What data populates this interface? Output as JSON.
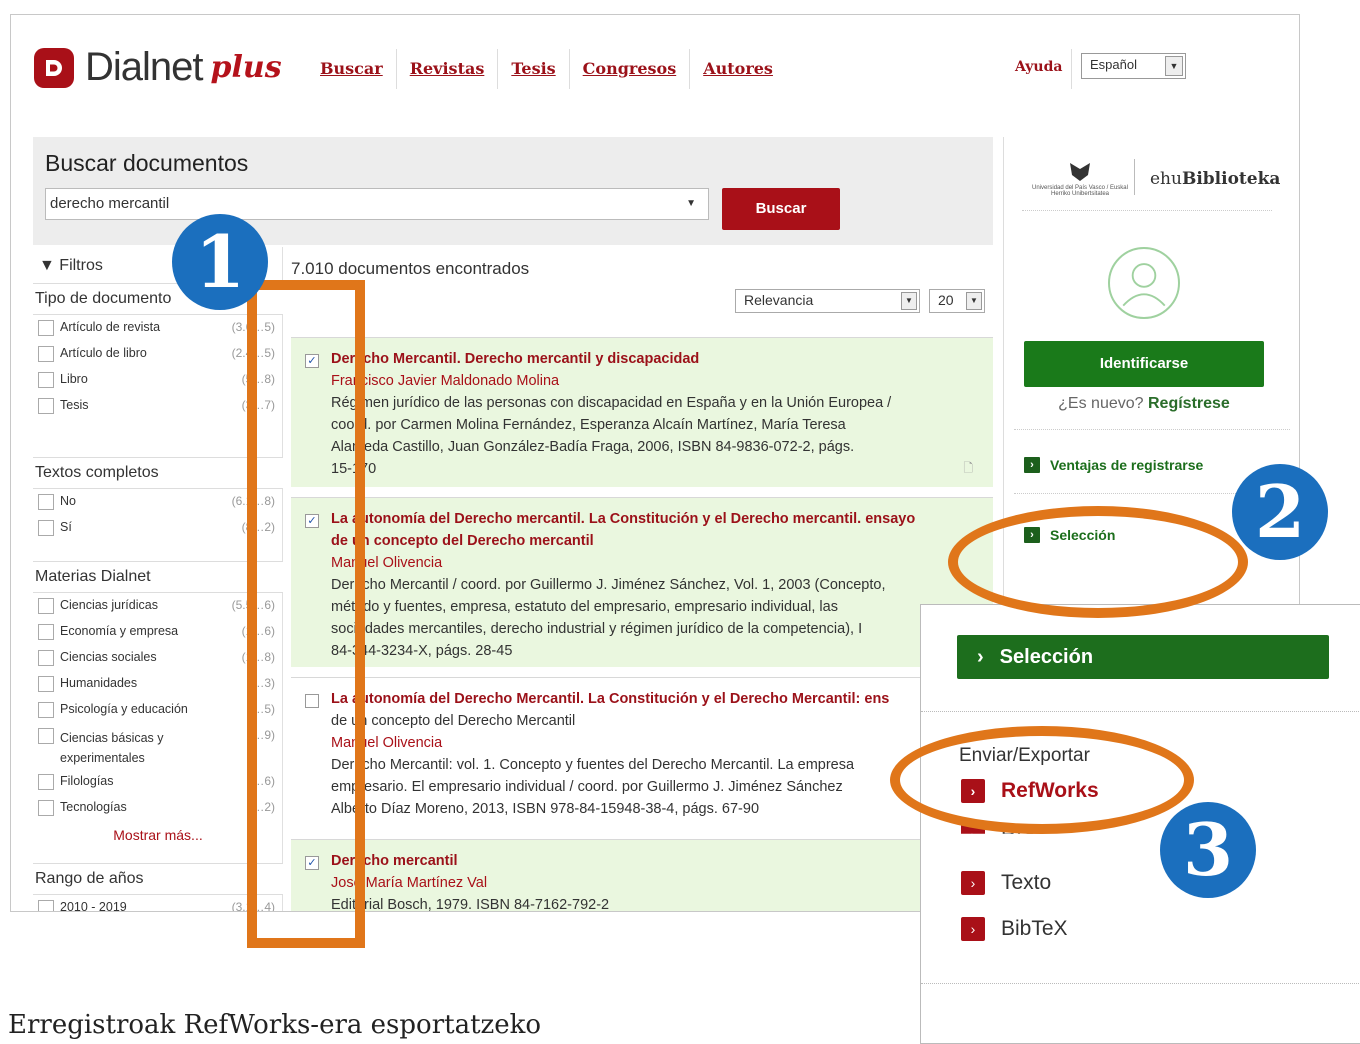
{
  "header": {
    "logo_text": "Dialnet",
    "logo_plus": "plus",
    "nav": [
      "Buscar",
      "Revistas",
      "Tesis",
      "Congresos",
      "Autores"
    ],
    "help": "Ayuda",
    "language": "Español"
  },
  "search": {
    "title": "Buscar documentos",
    "query": "derecho mercantil",
    "button": "Buscar"
  },
  "filters": {
    "header": "Filtros",
    "sections": [
      {
        "title": "Tipo de documento",
        "items": [
          {
            "label": "Artículo de revista",
            "count": "(3.6…5)"
          },
          {
            "label": "Artículo de libro",
            "count": "(2.4…5)"
          },
          {
            "label": "Libro",
            "count": "(5…8)"
          },
          {
            "label": "Tesis",
            "count": "(3…7)"
          }
        ]
      },
      {
        "title": "Textos completos",
        "items": [
          {
            "label": "No",
            "count": "(6.1…8)"
          },
          {
            "label": "Sí",
            "count": "(8…2)"
          }
        ]
      },
      {
        "title": "Materias Dialnet",
        "items": [
          {
            "label": "Ciencias jurídicas",
            "count": "(5.5…6)"
          },
          {
            "label": "Economía y empresa",
            "count": "(1…6)"
          },
          {
            "label": "Ciencias sociales",
            "count": "(1…8)"
          },
          {
            "label": "Humanidades",
            "count": "(…3)"
          },
          {
            "label": "Psicología y educación",
            "count": "(…5)"
          },
          {
            "label": "Ciencias básicas y experimentales",
            "count": "(…9)"
          },
          {
            "label": "Filologías",
            "count": "(…6)"
          },
          {
            "label": "Tecnologías",
            "count": "(…2)"
          }
        ]
      },
      {
        "title": "Rango de años",
        "items": [
          {
            "label": "2010 - 2019",
            "count": "(3.1…4)"
          }
        ]
      }
    ],
    "show_more": "Mostrar más..."
  },
  "results": {
    "count": "7.010 documentos encontrados",
    "sort": "Relevancia",
    "per_page": "20",
    "items": [
      {
        "title": "Derecho Mercantil. Derecho mercantil y discapacidad",
        "author": "Francisco Javier Maldonado Molina",
        "detail1": "Régimen jurídico de las personas con discapacidad en España y en la Unión Europea /",
        "detail2": "coord. por Carmen Molina Fernández, Esperanza Alcaín Martínez, María Teresa",
        "detail3": "Alameda Castillo, Juan González-Badía Fraga, 2006, ISBN 84-9836-072-2, págs.",
        "detail4": "15-170"
      },
      {
        "title": "La autonomía del Derecho mercantil. La Constitución y el Derecho mercantil. ensayo",
        "title2": "de un concepto del Derecho mercantil",
        "author": "Manuel Olivencia",
        "detail1": "Derecho Mercantil / coord. por Guillermo J. Jiménez Sánchez, Vol. 1, 2003 (Concepto,",
        "detail2": "método y fuentes, empresa, estatuto del empresario, empresario individual, las",
        "detail3": "sociedades mercantiles, derecho industrial y régimen jurídico de la competencia), I",
        "detail4": "84-344-3234-X, págs. 28-45"
      },
      {
        "title": "La autonomía del Derecho Mercantil. La Constitución y el Derecho Mercantil: ens",
        "title2": "de un concepto del Derecho Mercantil",
        "author": "Manuel Olivencia",
        "detail1": "Derecho Mercantil: vol. 1. Concepto y fuentes del Derecho Mercantil. La empresa",
        "detail2": "empresario. El empresario individual / coord. por Guillermo J. Jiménez Sánchez",
        "detail3": "Alberto Díaz Moreno, 2013, ISBN 978-84-15948-38-4, págs. 67-90"
      },
      {
        "title": "Derecho mercantil",
        "author": "José María Martínez Val",
        "detail1": "Editorial Bosch, 1979. ISBN 84-7162-792-2"
      }
    ]
  },
  "sidebar": {
    "university": "Universidad del País Vasco / Euskal Herriko Unibertsitatea",
    "library_prefix": "ehu",
    "library_suffix": "Biblioteka",
    "login": "Identificarse",
    "new_q": "¿Es nuevo?",
    "register": "Regístrese",
    "link_benefits": "Ventajas de registrarse",
    "link_selection": "Selección"
  },
  "zoom": {
    "selection": "Selección",
    "export_header": "Enviar/Exportar",
    "refworks": "RefWorks",
    "ris": "RIS",
    "texto": "Texto",
    "bibtex": "BibTeX"
  },
  "annotations": {
    "one": "1",
    "two": "2",
    "three": "3"
  },
  "caption": "Erregistroak RefWorks-era esportatzeko",
  "colors": {
    "brand_red": "#a91018",
    "green": "#1d6e1d",
    "highlight_orange": "#e0761a",
    "badge_blue": "#1b6fbe",
    "selected_bg": "#eaf7df"
  }
}
